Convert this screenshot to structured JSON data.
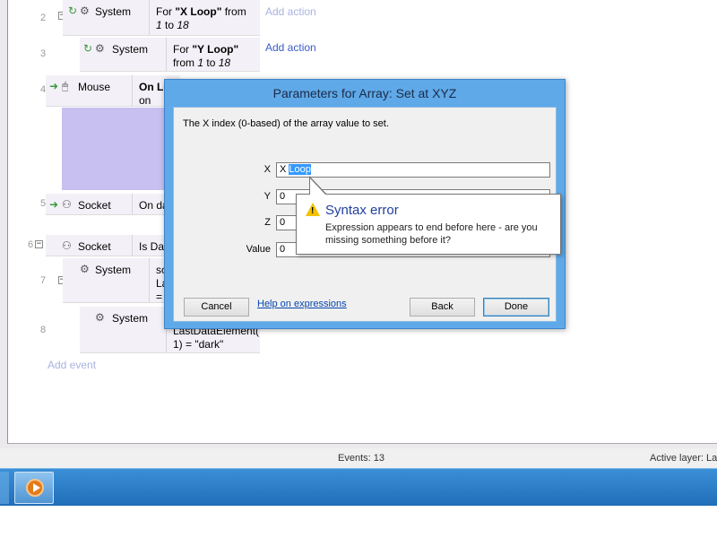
{
  "sheet": {
    "rows": [
      {
        "num": "2",
        "object": "System",
        "condition": [
          "For ",
          "\"X Loop\"",
          " from",
          "1",
          " to ",
          "18"
        ],
        "action": "Add action",
        "action_dim": true
      },
      {
        "num": "3",
        "object": "System",
        "condition": [
          "For ",
          "\"Y Loop\"",
          "",
          "from ",
          "1",
          " to ",
          "18"
        ],
        "action": "Add action",
        "action_dim": false
      },
      {
        "num": "4",
        "object": "Mouse",
        "condition": [
          "On Le",
          "on"
        ]
      },
      {
        "num": "5",
        "object": "Socket",
        "condition": [
          "On da"
        ]
      },
      {
        "num": "6",
        "object": "Socket",
        "condition": [
          "Is Dat"
        ]
      },
      {
        "num": "7",
        "object": "System",
        "condition": [
          "sc",
          "La",
          "="
        ]
      },
      {
        "num": "8",
        "object": "System",
        "condition": [
          "LastDataElement(",
          "1) = \"dark\""
        ]
      }
    ],
    "add_event": "Add event"
  },
  "status": {
    "events": "Events: 13",
    "active_layer": "Active layer: La"
  },
  "dialog": {
    "title": "Parameters for Array: Set at XYZ",
    "description": "The X index (0-based) of the array value to set.",
    "params": [
      {
        "label": "X",
        "value_prefix": "X ",
        "value_selected": "Loop"
      },
      {
        "label": "Y",
        "value": "0"
      },
      {
        "label": "Z",
        "value": "0"
      },
      {
        "label": "Value",
        "value": "0"
      }
    ],
    "buttons": {
      "cancel": "Cancel",
      "help": "Help on expressions",
      "back": "Back",
      "done": "Done"
    }
  },
  "tooltip": {
    "title": "Syntax error",
    "message": "Expression appears to end before here - are you missing something before it?"
  },
  "colors": {
    "accent": "#5fa9e8",
    "error_title": "#1f3fa0",
    "warning_icon": "#f2c200",
    "selection": "#3399ff"
  }
}
